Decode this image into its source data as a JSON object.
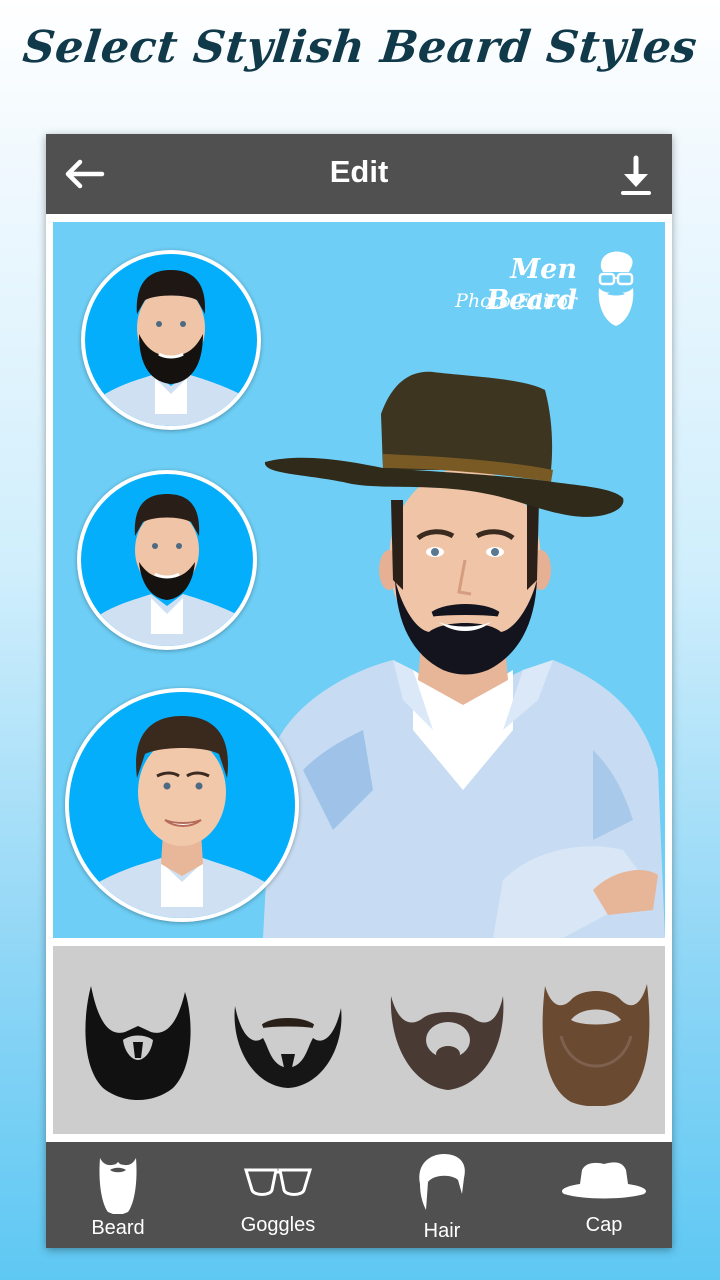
{
  "promo": {
    "headline": "Select Stylish Beard Styles"
  },
  "appbar": {
    "title": "Edit",
    "back_icon": "arrow-left-icon",
    "download_icon": "download-icon"
  },
  "logo": {
    "line1": "Men Beard",
    "line2": "Photo Editor",
    "icon": "bearded-man-icon"
  },
  "thumbnails": [
    {
      "label": "Full beard preview",
      "style": "full-beard"
    },
    {
      "label": "Short beard preview",
      "style": "short-beard"
    },
    {
      "label": "Original photo",
      "style": "no-beard"
    }
  ],
  "beard_options": [
    {
      "name": "beard-style-1",
      "color": "#111111"
    },
    {
      "name": "beard-style-2",
      "color": "#1a1a1a"
    },
    {
      "name": "beard-style-3",
      "color": "#4a3a34"
    },
    {
      "name": "beard-style-4",
      "color": "#6b4a32"
    }
  ],
  "bottom_nav": [
    {
      "label": "Beard",
      "icon": "beard-icon"
    },
    {
      "label": "Goggles",
      "icon": "goggles-icon"
    },
    {
      "label": "Hair",
      "icon": "hair-icon"
    },
    {
      "label": "Cap",
      "icon": "cap-icon"
    }
  ],
  "colors": {
    "appbar": "#505050",
    "canvas": "#6ecef5",
    "thumb_bg": "#04aefb",
    "tray": "#cdcdcd",
    "headline": "#10394a"
  }
}
